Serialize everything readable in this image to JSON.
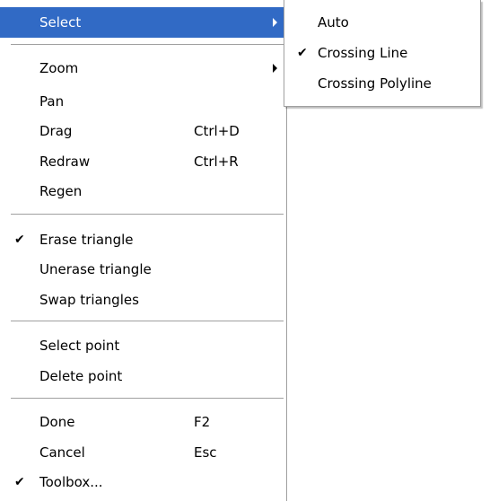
{
  "colors": {
    "highlight_bg": "#316ac5",
    "highlight_text": "#ffffff",
    "text": "#000000",
    "separator": "#a0a0a0"
  },
  "main_menu": {
    "select": {
      "label": "Select",
      "icon": "chevron-right-icon"
    },
    "zoom": {
      "label": "Zoom",
      "icon": "chevron-right-icon"
    },
    "pan": {
      "label": "Pan"
    },
    "drag": {
      "label": "Drag",
      "shortcut": "Ctrl+D"
    },
    "redraw": {
      "label": "Redraw",
      "shortcut": "Ctrl+R"
    },
    "regen": {
      "label": "Regen"
    },
    "erase_triangle": {
      "label": "Erase triangle",
      "checked": true,
      "icon": "checkmark-icon"
    },
    "unerase_triangle": {
      "label": "Unerase triangle"
    },
    "swap_triangles": {
      "label": "Swap triangles"
    },
    "select_point": {
      "label": "Select point"
    },
    "delete_point": {
      "label": "Delete point"
    },
    "done": {
      "label": "Done",
      "shortcut": "F2"
    },
    "cancel": {
      "label": "Cancel",
      "shortcut": "Esc"
    },
    "toolbox": {
      "label": "Toolbox...",
      "checked": true,
      "icon": "checkmark-icon"
    }
  },
  "sub_menu": {
    "auto": {
      "label": "Auto"
    },
    "crossing_line": {
      "label": "Crossing Line",
      "checked": true,
      "icon": "checkmark-icon"
    },
    "crossing_polyline": {
      "label": "Crossing Polyline"
    }
  }
}
